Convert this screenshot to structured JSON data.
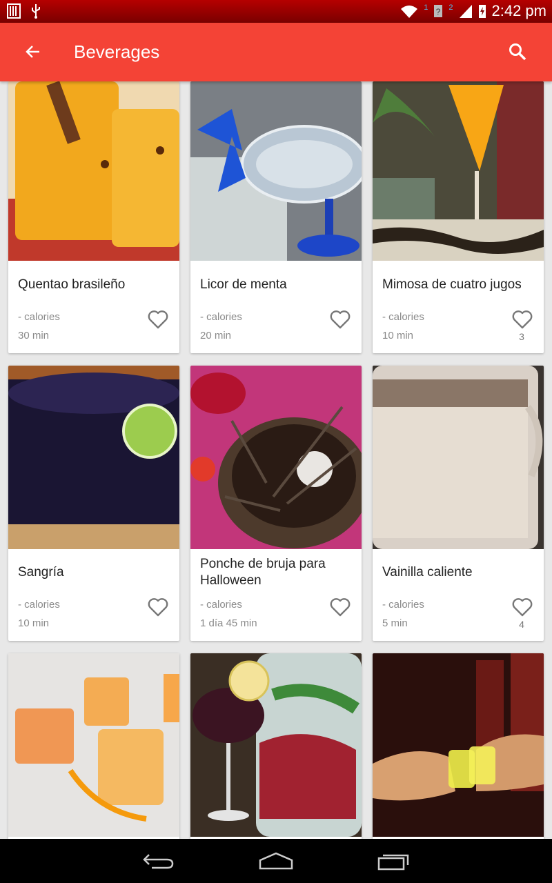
{
  "status_bar": {
    "time": "2:42 pm",
    "sim1_label": "1",
    "sim2_label": "2"
  },
  "app_bar": {
    "title": "Beverages",
    "color": "#f44336"
  },
  "recipes": [
    {
      "title": "Quentao brasileño",
      "calories": "- calories",
      "time": "30 min",
      "favorites": ""
    },
    {
      "title": "Licor de menta",
      "calories": "- calories",
      "time": "20 min",
      "favorites": ""
    },
    {
      "title": "Mimosa de cuatro jugos",
      "calories": "- calories",
      "time": "10 min",
      "favorites": "3"
    },
    {
      "title": "Sangría",
      "calories": "- calories",
      "time": "10 min",
      "favorites": ""
    },
    {
      "title": "Ponche de bruja para Halloween",
      "calories": "- calories",
      "time": "1 día 45 min",
      "favorites": ""
    },
    {
      "title": "Vainilla caliente",
      "calories": "- calories",
      "time": "5 min",
      "favorites": "4"
    },
    {
      "title": "",
      "calories": "",
      "time": "",
      "favorites": ""
    },
    {
      "title": "",
      "calories": "",
      "time": "",
      "favorites": ""
    },
    {
      "title": "",
      "calories": "",
      "time": "",
      "favorites": ""
    }
  ],
  "icons": {
    "back": "arrow-back-icon",
    "search": "search-icon",
    "favorite": "heart-outline-icon",
    "nav_back": "nav-back-icon",
    "nav_home": "nav-home-icon",
    "nav_recents": "nav-recents-icon"
  }
}
